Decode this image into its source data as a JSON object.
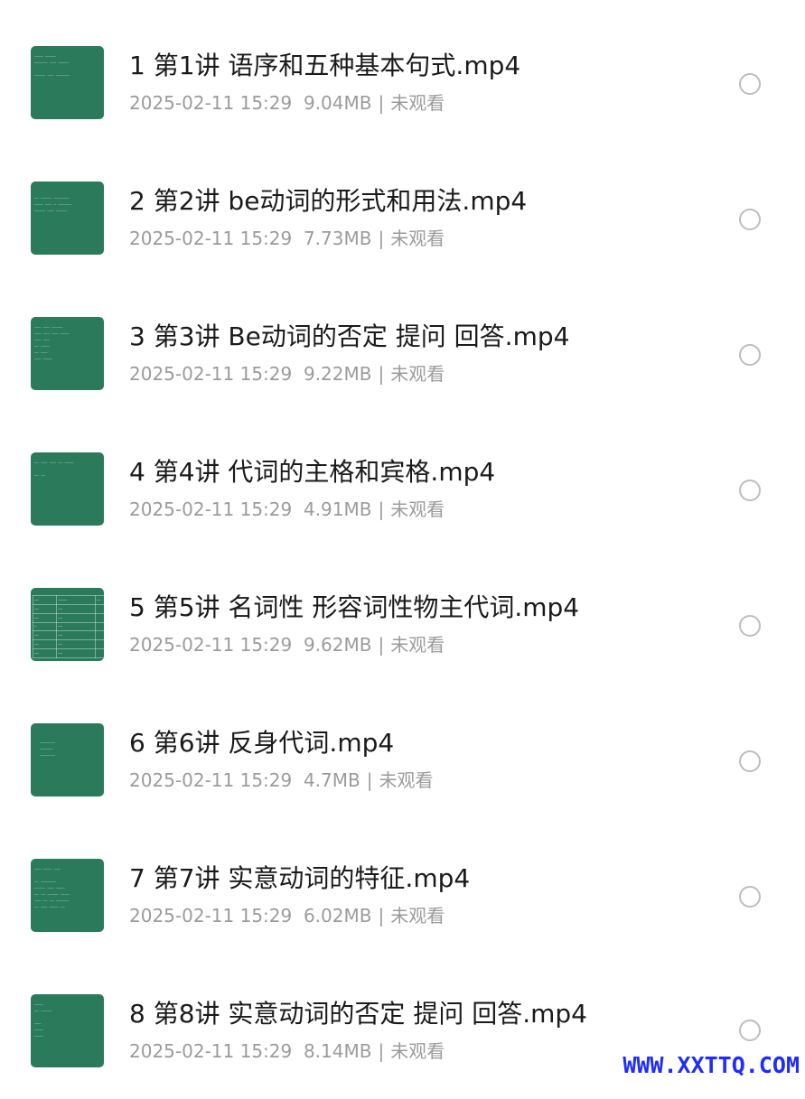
{
  "files": [
    {
      "title": "1 第1讲 语序和五种基本句式.mp4",
      "date": "2025-02-11 15:29",
      "size": "9.04MB",
      "separator": "|",
      "status": "未观看",
      "selected": false
    },
    {
      "title": "2 第2讲 be动词的形式和用法.mp4",
      "date": "2025-02-11 15:29",
      "size": "7.73MB",
      "separator": "|",
      "status": "未观看",
      "selected": false
    },
    {
      "title": "3 第3讲 Be动词的否定 提问 回答.mp4",
      "date": "2025-02-11 15:29",
      "size": "9.22MB",
      "separator": "|",
      "status": "未观看",
      "selected": false
    },
    {
      "title": "4 第4讲 代词的主格和宾格.mp4",
      "date": "2025-02-11 15:29",
      "size": "4.91MB",
      "separator": "|",
      "status": "未观看",
      "selected": false
    },
    {
      "title": "5 第5讲 名词性 形容词性物主代词.mp4",
      "date": "2025-02-11 15:29",
      "size": "9.62MB",
      "separator": "|",
      "status": "未观看",
      "selected": false
    },
    {
      "title": "6 第6讲 反身代词.mp4",
      "date": "2025-02-11 15:29",
      "size": "4.7MB",
      "separator": "|",
      "status": "未观看",
      "selected": false
    },
    {
      "title": "7 第7讲 实意动词的特征.mp4",
      "date": "2025-02-11 15:29",
      "size": "6.02MB",
      "separator": "|",
      "status": "未观看",
      "selected": false
    },
    {
      "title": "8 第8讲 实意动词的否定 提问 回答.mp4",
      "date": "2025-02-11 15:29",
      "size": "8.14MB",
      "separator": "|",
      "status": "未观看",
      "selected": false
    }
  ],
  "watermark": "WWW.XXTTQ.COM",
  "colors": {
    "thumbnail_bg": "#2b7a5b",
    "title_text": "#1a1a1a",
    "meta_text": "#9b9b9b",
    "radio_border": "#bdbdbd",
    "watermark": "#1f2cff"
  }
}
